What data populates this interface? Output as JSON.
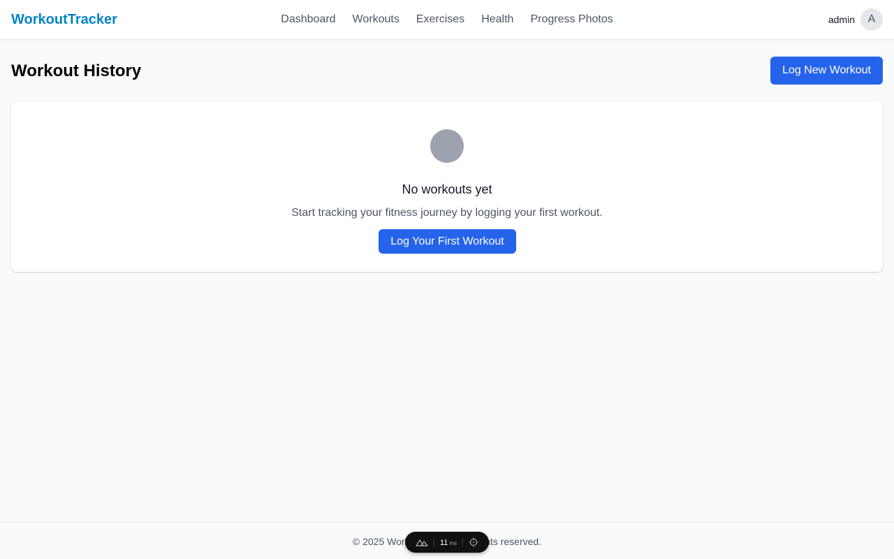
{
  "header": {
    "brand": "WorkoutTracker",
    "nav": [
      "Dashboard",
      "Workouts",
      "Exercises",
      "Health",
      "Progress Photos"
    ],
    "username": "admin",
    "avatar_initial": "A"
  },
  "main": {
    "title": "Workout History",
    "log_new_label": "Log New Workout",
    "empty_state": {
      "title": "No workouts yet",
      "description": "Start tracking your fitness journey by logging your first workout.",
      "cta_label": "Log Your First Workout"
    }
  },
  "footer": {
    "text": "© 2025 WorkoutTracker. All rights reserved."
  },
  "devtools": {
    "timing": "11",
    "unit": "ms"
  },
  "colors": {
    "brand": "#0284c7",
    "primary": "#2563eb",
    "background": "#f9fafb"
  }
}
